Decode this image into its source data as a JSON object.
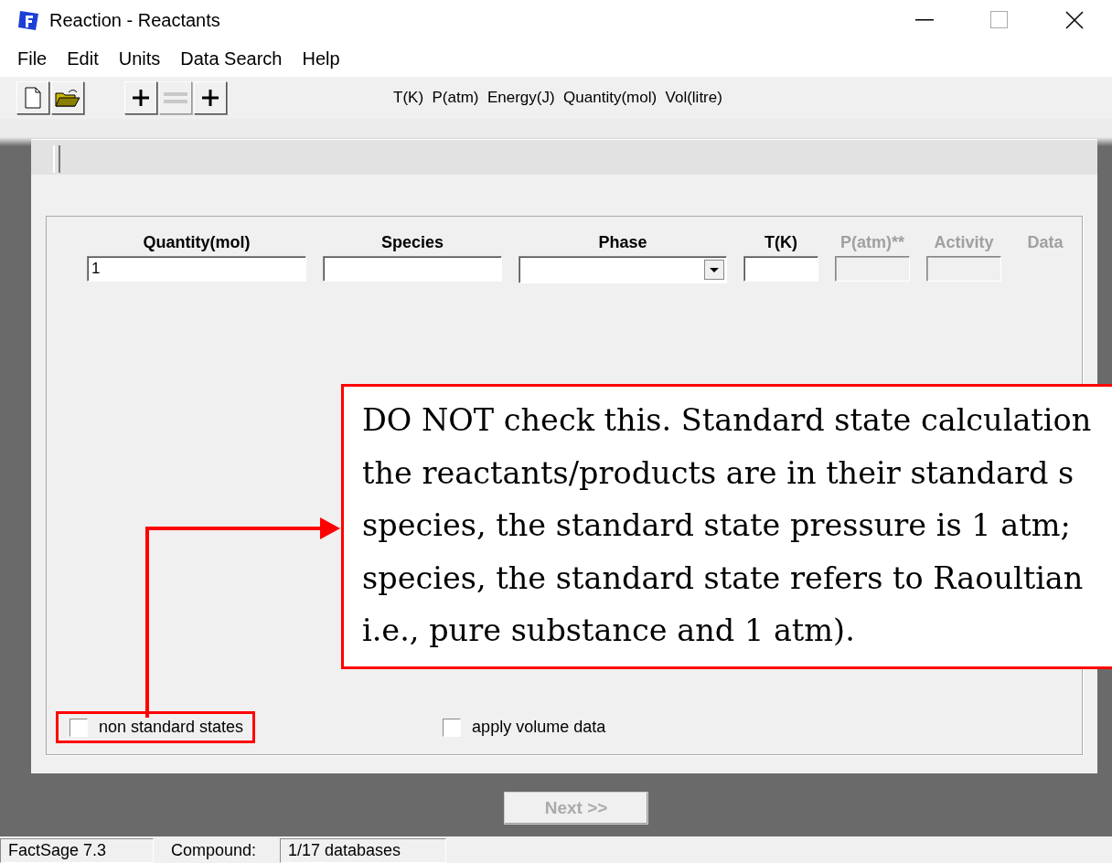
{
  "window": {
    "title": "Reaction - Reactants"
  },
  "menu": [
    "File",
    "Edit",
    "Units",
    "Data Search",
    "Help"
  ],
  "toolbar": {
    "buttons": [
      {
        "kind": "new",
        "disabled": false
      },
      {
        "kind": "open",
        "disabled": false
      },
      {
        "kind": "plus",
        "disabled": false
      },
      {
        "kind": "equals",
        "disabled": true
      },
      {
        "kind": "plus",
        "disabled": false
      }
    ],
    "units": "T(K)  P(atm)  Energy(J)  Quantity(mol)  Vol(litre)"
  },
  "columns": [
    {
      "label": "Quantity(mol)",
      "kind": "text",
      "disabled": false,
      "value": "1"
    },
    {
      "label": "Species",
      "kind": "text",
      "disabled": false
    },
    {
      "label": "Phase",
      "kind": "dropdown",
      "disabled": false
    },
    {
      "label": "T(K)",
      "kind": "text",
      "disabled": false
    },
    {
      "label": "P(atm)**",
      "kind": "text",
      "disabled": true
    },
    {
      "label": "Activity",
      "kind": "text",
      "disabled": true
    },
    {
      "label": "Data",
      "kind": "none",
      "disabled": true
    }
  ],
  "checkboxes": [
    {
      "label": "non standard states",
      "checked": false,
      "highlighted": true
    },
    {
      "label": "apply volume data",
      "checked": false,
      "highlighted": false
    }
  ],
  "next_button": {
    "label": "Next >>",
    "disabled": true
  },
  "callout": {
    "lines": [
      "DO NOT check this. Standard state calculation",
      "the reactants/products are in their standard s",
      "species, the standard state pressure is 1 atm;",
      "species, the standard state refers to Raoultian",
      "i.e., pure substance and 1 atm)."
    ]
  },
  "status_bar": [
    "FactSage 7.3",
    "Compound:",
    "1/17 databases"
  ]
}
